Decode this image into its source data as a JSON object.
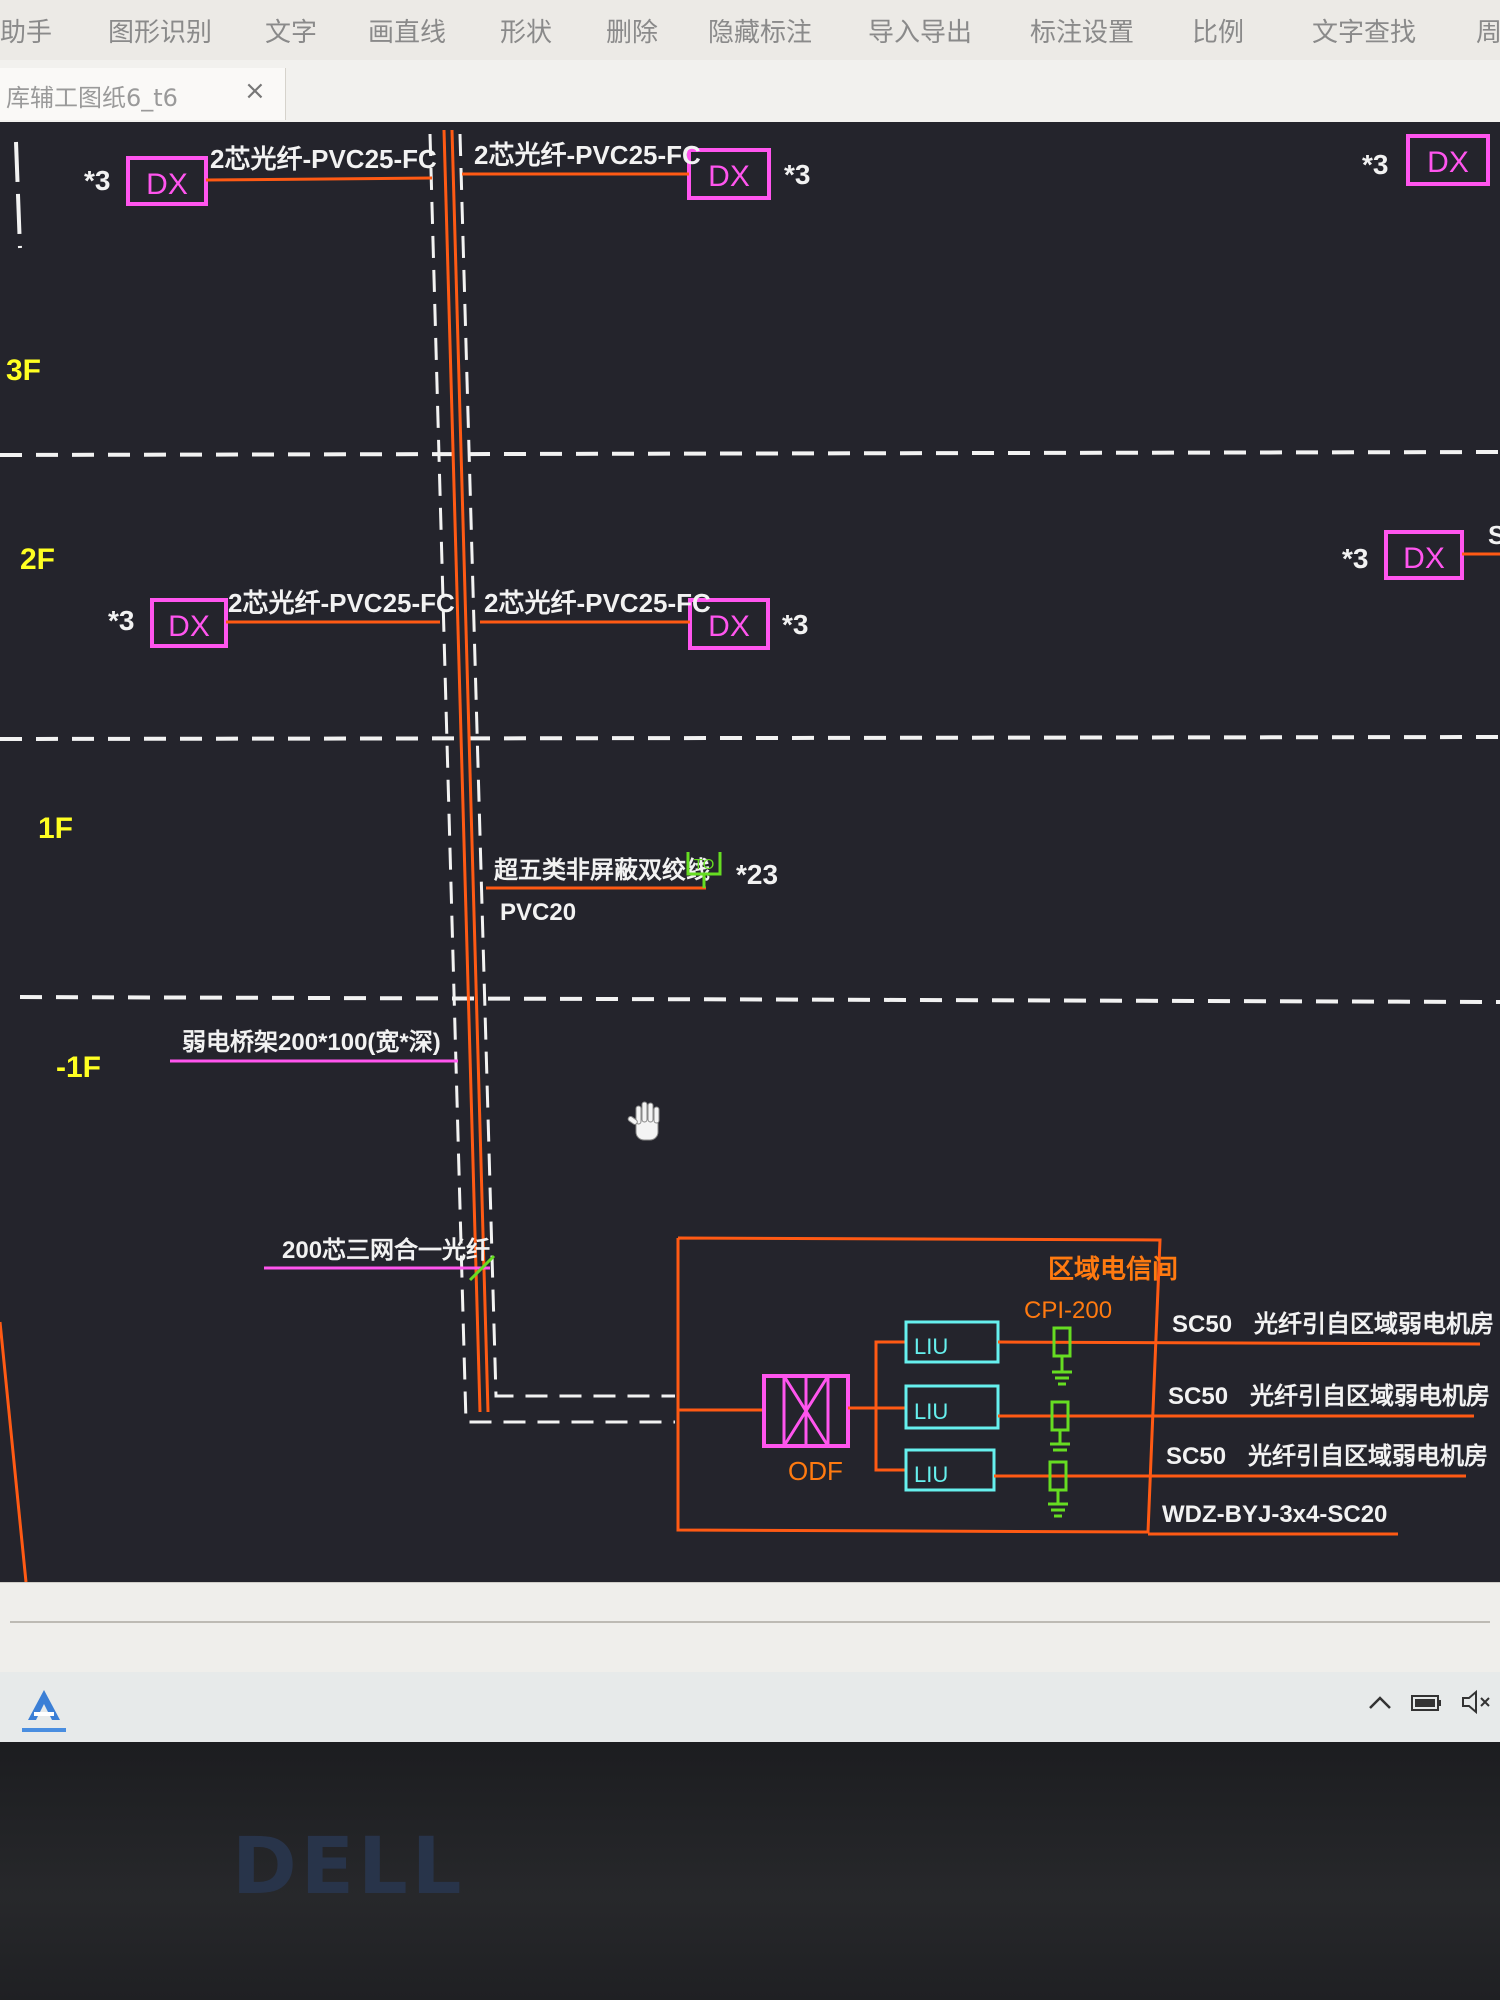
{
  "toolbar": {
    "items": [
      "助手",
      "图形识别",
      "文字",
      "画直线",
      "形状",
      "删除",
      "隐藏标注",
      "导入导出",
      "标注设置",
      "比例",
      "文字查找",
      "周"
    ]
  },
  "tab": {
    "title": "库辅工图纸6_t6",
    "close_label": "×"
  },
  "drawing": {
    "floors": [
      "3F",
      "2F",
      "1F",
      "-1F"
    ],
    "outlet_label": "DX",
    "qty_3": "*3",
    "qty_23": "*23",
    "cable_fiber": "2芯光纤-PVC25-FC",
    "cable_fiber_2": "2芯光纤-PVC25-FC",
    "cable_fiber_3": "2芯光纤-PVC25-FC",
    "cable_fiber_4": "2芯光纤-PVC25-FC",
    "to_symbol": "TO",
    "twisted_pair": "超五类非屏蔽双绞线",
    "pvc20": "PVC20",
    "tray": "弱电桥架200*100(宽*深)",
    "trunk_fiber": "200芯三网合一光纤",
    "room_label": "区域电信间",
    "cp_label": "CPI-200",
    "odf_label": "ODF",
    "liu": "LIU",
    "sc50": "SC50",
    "fiber_to_room": "光纤引自区域弱电机房",
    "power_cable": "WDZ-BYJ-3x4-SC20",
    "edge_s": "S"
  },
  "colors": {
    "background": "#24242c",
    "floor_text": "#ffff22",
    "magenta": "#ff55ee",
    "orange": "#ff5a14",
    "white": "#f2f2f2",
    "green": "#66dd22",
    "cyan": "#66f0ee",
    "cable_label": "#f2f2f2",
    "orange_label": "#ff7a10"
  },
  "taskbar": {
    "tray_icons": [
      "chevron-up-icon",
      "battery-icon",
      "speaker-muted-icon"
    ]
  },
  "bezel": {
    "logo": "DELL"
  }
}
